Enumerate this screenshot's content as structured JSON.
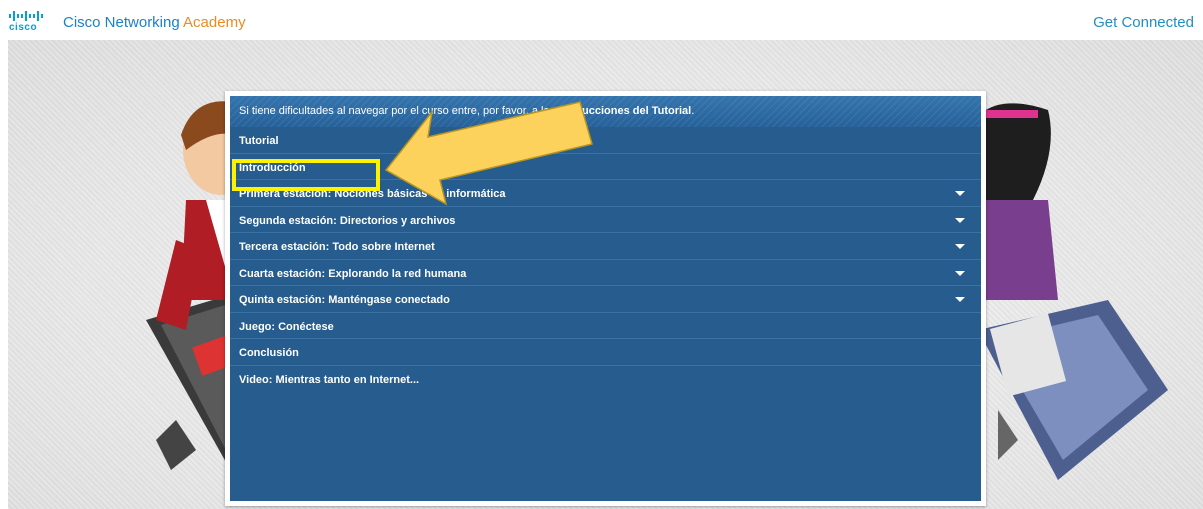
{
  "header": {
    "logo_word": "cisco",
    "brand_main": "Cisco Networking ",
    "brand_accent": "Academy",
    "get_connected": "Get Connected"
  },
  "panel": {
    "notice_pre": "Si tiene dificultades al navegar por el curso entre, por favor, a las ",
    "notice_link": "Instrucciones del Tutorial",
    "notice_post": ".",
    "items": [
      {
        "label": "Tutorial",
        "expandable": false
      },
      {
        "label": "Introducción",
        "expandable": false
      },
      {
        "label": "Primera estación: Nociones básicas de informática",
        "expandable": true
      },
      {
        "label": "Segunda estación: Directorios y archivos",
        "expandable": true
      },
      {
        "label": "Tercera estación: Todo sobre Internet",
        "expandable": true
      },
      {
        "label": "Cuarta estación: Explorando la red humana",
        "expandable": true
      },
      {
        "label": "Quinta estación: Manténgase conectado",
        "expandable": true
      },
      {
        "label": "Juego: Conéctese",
        "expandable": false
      },
      {
        "label": "Conclusión",
        "expandable": false
      },
      {
        "label": "Video: Mientras tanto en Internet...",
        "expandable": false
      }
    ]
  },
  "colors": {
    "panel_bg": "#265d8e",
    "highlight": "#fff200",
    "arrow": "#fcd15c",
    "cisco_blue": "#049fd9",
    "academy_orange": "#ec8b21"
  },
  "icons": {
    "logo": "cisco-logo-icon",
    "caret": "chevron-down-icon"
  }
}
